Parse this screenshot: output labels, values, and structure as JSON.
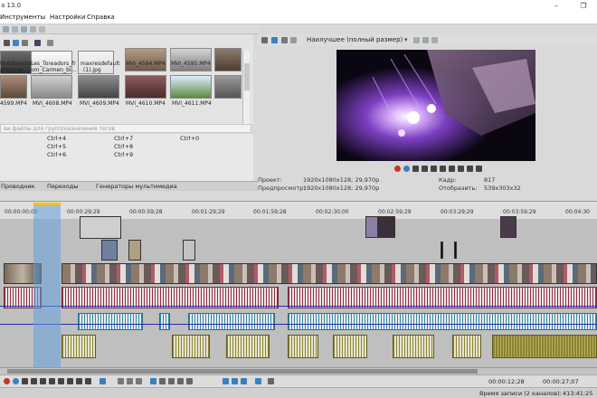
{
  "window": {
    "title": "a 13.0",
    "minimize_glyph": "–",
    "restore_glyph": "❐"
  },
  "menu": {
    "items": [
      "Инструменты",
      "Настройки",
      "Справка"
    ]
  },
  "media": {
    "files_row1": [
      {
        "label_a": "hberbenstein",
        "label_b": "pretty-w..."
      },
      {
        "label_a": "Les_Toreadors_fr",
        "label_b": "om_Carmen_bi..."
      },
      {
        "label_a": "maxresdefault",
        "label_b": "(1).jpg"
      },
      {
        "label_a": "MVI_4594.MP4",
        "label_b": ""
      },
      {
        "label_a": "MVI_4595.MP4",
        "label_b": ""
      }
    ],
    "files_row2": [
      {
        "label_a": "4599.MP4"
      },
      {
        "label_a": "MVI_4608.MP4"
      },
      {
        "label_a": "MVI_4609.MP4"
      },
      {
        "label_a": "MVI_4610.MP4"
      },
      {
        "label_a": "MVI_4611.MP4"
      }
    ],
    "filter_placeholder": "ви файлы для групп/назначения тегов"
  },
  "shortcuts": {
    "col1": [
      "Ctrl+4",
      "Ctrl+5",
      "Ctrl+6"
    ],
    "col2": [
      "Ctrl+7",
      "Ctrl+8",
      "Ctrl+9"
    ],
    "col3": [
      "Ctrl+0"
    ]
  },
  "left_tabs": [
    "Проводник",
    "Переходы",
    "Генераторы мультимедиа"
  ],
  "preview": {
    "quality_label": "Наилучшее (полный размер)",
    "project_label": "Проект:",
    "project_value": "1920x1080x128; 29,970p",
    "preview_label": "Предпросмотр:",
    "preview_value": "1920x1080x128; 29,970p",
    "frame_label": "Кадр:",
    "frame_value": "817",
    "display_label": "Отобразить:",
    "display_value": "539x303x32"
  },
  "timeline": {
    "ruler_times": [
      "00:00:00;00",
      "00:00:29;29",
      "00:00:59;28",
      "00:01:29;29",
      "00:01:59;28",
      "00:02:30;00",
      "00:02:59;29",
      "00:03:29;29",
      "00:03:59;29",
      "00:04:30"
    ],
    "current_time": "00:00:27;07",
    "length_time": "00:00:12;28"
  },
  "status": {
    "record_time_label": "Время записи (2 каналов):",
    "record_time_value": "413:41:25"
  },
  "colors": {
    "audio_red": "#8e2d45",
    "audio_teal": "#2e87a6",
    "audio_olive": "#8a8430",
    "loop_region": "#64a0dc",
    "video_glow": "#b070ff"
  }
}
